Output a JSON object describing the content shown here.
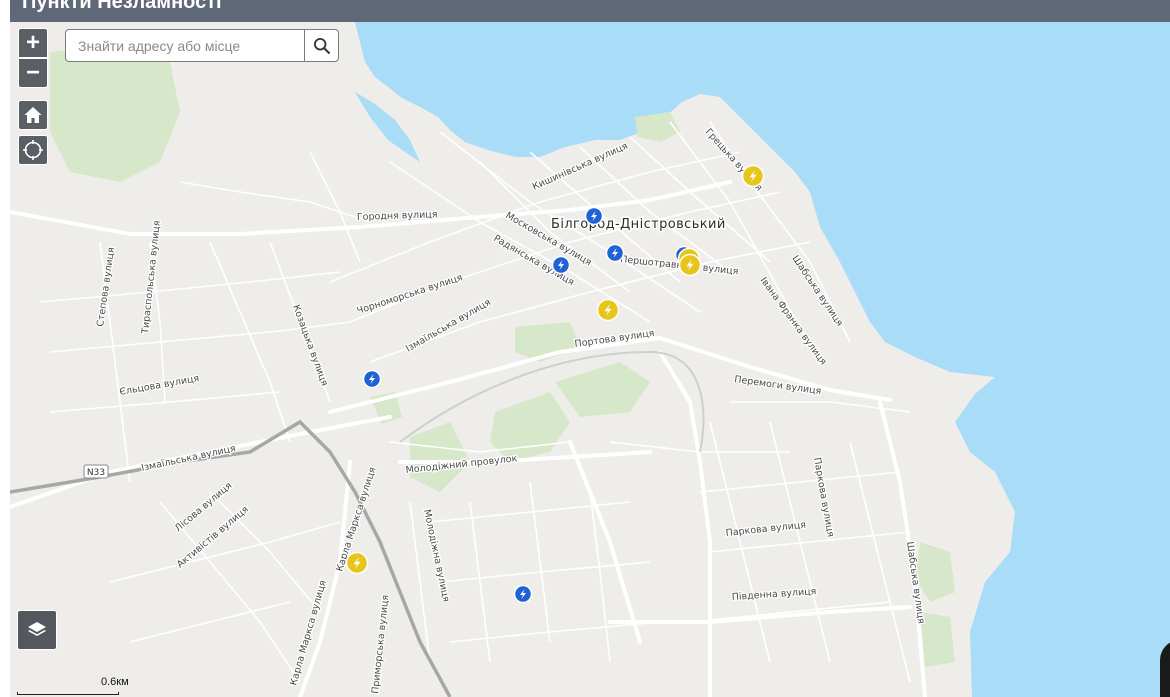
{
  "header": {
    "title": "Пункти Незламності"
  },
  "search": {
    "placeholder": "Знайти адресу або місце"
  },
  "controls": {
    "zoom_in": "+",
    "zoom_out": "−",
    "home_icon": "home-icon",
    "locate_icon": "crosshair-icon",
    "layers_icon": "layers-icon",
    "search_icon": "search-icon"
  },
  "map": {
    "city": "Білгород-Дністровський",
    "highway": "N33",
    "streets": {
      "kyshynivska": "Кишинівська вулиця",
      "hretska": "Грецька вулиця",
      "horodnia": "Городня вулиця",
      "moskovska": "Московська вулиця",
      "radianska": "Радянська вулиця",
      "pershotravneva": "Першотравнева вулиця",
      "shabska1": "Шабська вулиця",
      "ivana_franka": "Івана Франка вулиця",
      "stepova": "Степова вулиця",
      "tyraspolska": "Тираспольська вулиця",
      "chornomorska": "Чорноморська вулиця",
      "izmailska1": "Ізмаїльська вулиця",
      "kozatska": "Козацька вулиця",
      "portova": "Портова вулиця",
      "peremohy": "Перемоги вулиця",
      "eltsova": "Єльцова вулиця",
      "izmailska2": "Ізмаїльська вулиця",
      "molodizhnyi_provulok": "Молодіжний провулок",
      "parkova1": "Паркова вулиця",
      "parkova2": "Паркова вулиця",
      "lisova": "Лісова вулиця",
      "aktyvistiv": "Активістів вулиця",
      "karla_marksa1": "Карла Маркса вулиця",
      "molodizhna": "Молодіжна вулиця",
      "pivdenna": "Південна вулиця",
      "shabska2": "Шабська вулиця",
      "karla_marksa2": "Карла Маркса вулиця",
      "prymorska": "Приморська вулиця"
    },
    "markers": {
      "icon": "lightning-icon",
      "blue_color": "#1f62d6",
      "yellow_color": "#e8c51a"
    }
  },
  "colors": {
    "water": "#a8dcf7",
    "land": "#eeedea",
    "park": "#d7e7c9",
    "header": "#5f6878",
    "control": "#5a5f66"
  },
  "scale": {
    "label": "0.6км"
  }
}
